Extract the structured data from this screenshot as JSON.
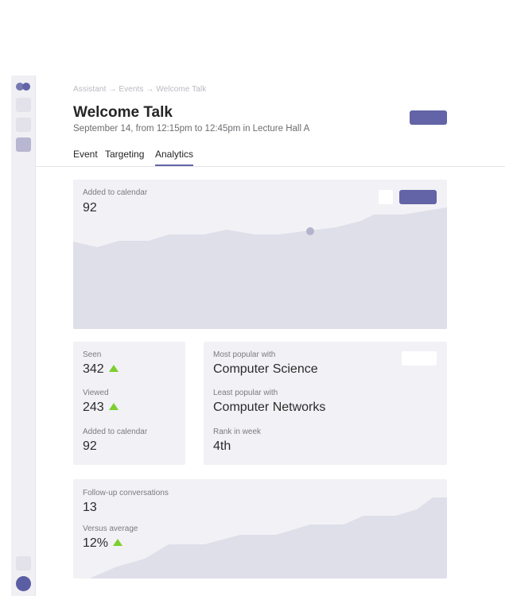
{
  "breadcrumb": "Assistant → Events → Welcome Talk",
  "event": {
    "title": "Welcome Talk",
    "subtitle": "September 14, from 12:15pm to 12:45pm in Lecture Hall A"
  },
  "tabs": [
    {
      "label": "Event",
      "active": false
    },
    {
      "label": "Targeting",
      "active": false
    },
    {
      "label": "Analytics",
      "active": true
    }
  ],
  "calendar_card": {
    "label": "Added to calendar",
    "value": "92"
  },
  "stats_card": {
    "seen": {
      "label": "Seen",
      "value": "342",
      "trend": "up"
    },
    "viewed": {
      "label": "Viewed",
      "value": "243",
      "trend": "up"
    },
    "added": {
      "label": "Added to calendar",
      "value": "92"
    }
  },
  "popularity_card": {
    "most": {
      "label": "Most popular with",
      "value": "Computer Science"
    },
    "least": {
      "label": "Least popular with",
      "value": "Computer Networks"
    },
    "rank": {
      "label": "Rank in week",
      "value": "4th"
    }
  },
  "followup_card": {
    "conversations": {
      "label": "Follow-up conversations",
      "value": "13"
    },
    "versus": {
      "label": "Versus average",
      "value": "12%",
      "trend": "up"
    }
  },
  "colors": {
    "accent": "#6264a7",
    "trend_up": "#7bcf2e",
    "area_fill": "#dfdfea",
    "card_bg": "#f2f1f6"
  }
}
